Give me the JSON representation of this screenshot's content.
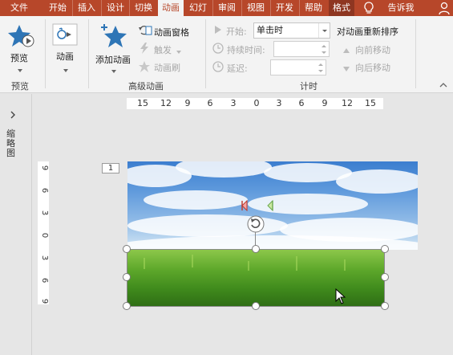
{
  "tabs": [
    {
      "label": "文件"
    },
    {
      "label": "开始"
    },
    {
      "label": "插入"
    },
    {
      "label": "设计"
    },
    {
      "label": "切换"
    },
    {
      "label": "动画"
    },
    {
      "label": "幻灯"
    },
    {
      "label": "审阅"
    },
    {
      "label": "视图"
    },
    {
      "label": "开发"
    },
    {
      "label": "帮助"
    },
    {
      "label": "格式"
    },
    {
      "label": "告诉我"
    }
  ],
  "ribbon": {
    "preview": {
      "label": "预览",
      "group": "预览"
    },
    "animation": {
      "label": "动画"
    },
    "add_animation": {
      "label": "添加动画"
    },
    "animation_pane": {
      "label": "动画窗格"
    },
    "trigger": {
      "label": "触发"
    },
    "animation_painter": {
      "label": "动画刷"
    },
    "advanced_group": "高级动画",
    "start_label": "开始:",
    "start_value": "单击时",
    "duration_label": "持续时间:",
    "delay_label": "延迟:",
    "timing_group": "计时",
    "reorder_title": "对动画重新排序",
    "move_earlier": "向前移动",
    "move_later": "向后移动"
  },
  "left_pane": {
    "vertical_label": "缩略图"
  },
  "ruler_h": [
    "15",
    "12",
    "9",
    "6",
    "3",
    "0",
    "3",
    "6",
    "9",
    "12",
    "15"
  ],
  "ruler_v": [
    "9",
    "6",
    "3",
    "0",
    "3",
    "6",
    "9"
  ],
  "slide_number": "1",
  "colors": {
    "accent": "#b7472a",
    "ribbon": "#f3f3f3",
    "format_tab": "#8e3621"
  }
}
